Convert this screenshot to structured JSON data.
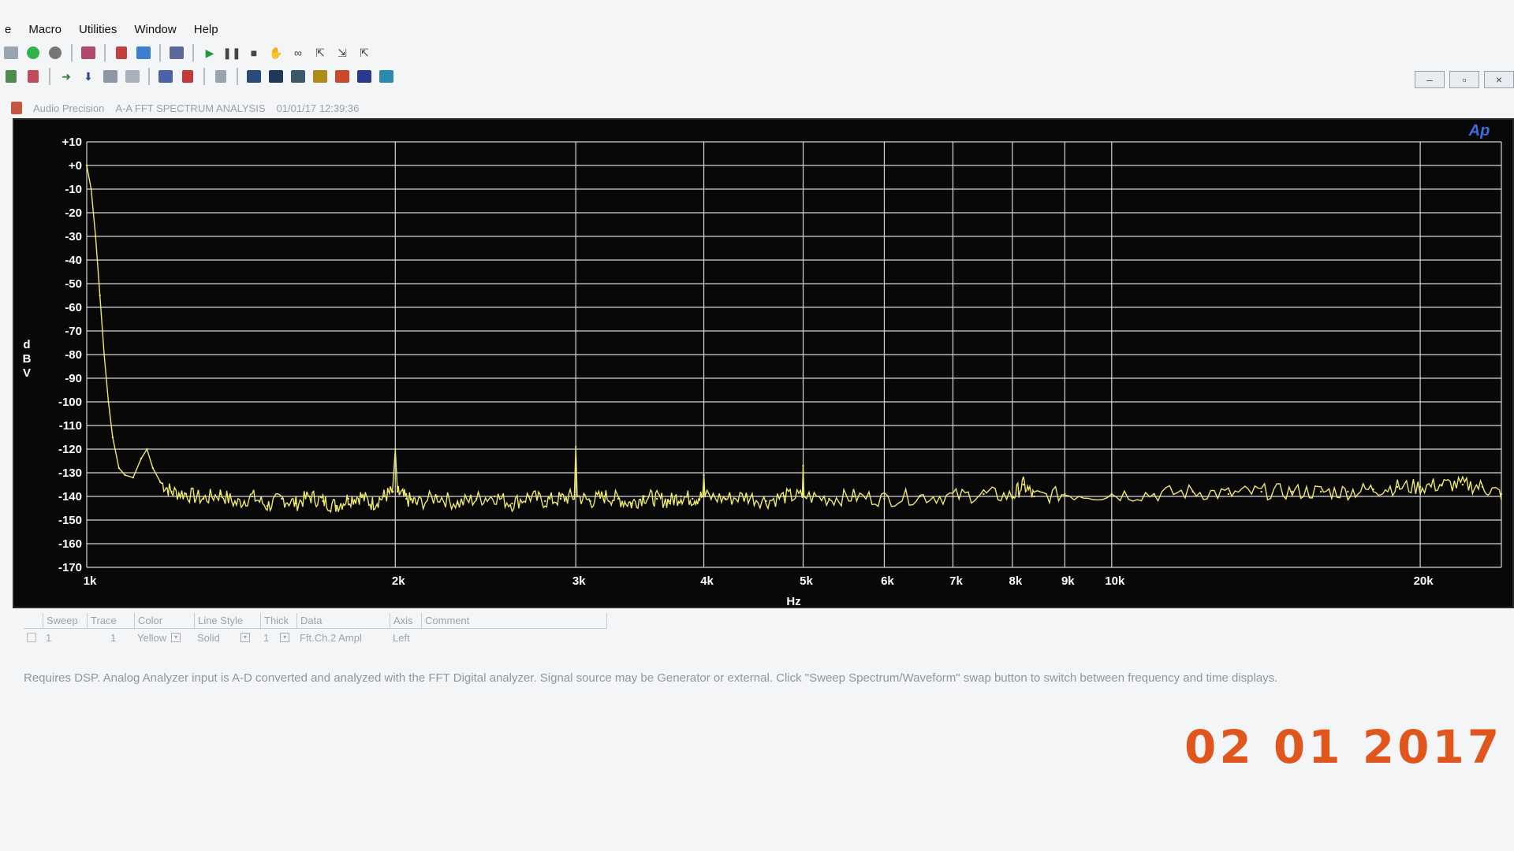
{
  "menu": [
    "e",
    "Macro",
    "Utilities",
    "Window",
    "Help"
  ],
  "toolbar_icons": {
    "row1": [
      "open-icon",
      "run-green-icon",
      "stop-circle-icon",
      "sweep-icon",
      "copy-icon",
      "paste-icon",
      "panel-icon",
      "play-icon",
      "pause-icon",
      "stop-icon",
      "hand-icon",
      "zoom-icon",
      "cursor-icon",
      "graph-in-icon",
      "graph-out-icon"
    ],
    "row2": [
      "tool-a-icon",
      "tool-b-icon",
      "arrow-right-icon",
      "arrow-down-icon",
      "grid-icon",
      "table-icon",
      "meter-icon",
      "filter-icon",
      "page-icon",
      "graph1-icon",
      "graph2-icon",
      "graph3-icon",
      "graph4-icon",
      "graph5-icon",
      "graph6-icon",
      "graph7-icon"
    ]
  },
  "window_controls": [
    "–",
    "▫",
    "×"
  ],
  "graph_window": {
    "app": "Audio Precision",
    "title": "A-A FFT SPECTRUM ANALYSIS",
    "timestamp": "01/01/17 12:39:36",
    "logo": "Ap"
  },
  "colors": {
    "trace": "#ede86a",
    "grid": "#d6d6d6",
    "background": "#080808",
    "date_stamp": "#e0561c"
  },
  "chart_data": {
    "type": "line",
    "xlabel": "Hz",
    "ylabel": "dBV",
    "x_scale": "log",
    "xlim": [
      1000,
      24000
    ],
    "ylim": [
      -170,
      10
    ],
    "grid": true,
    "x_ticks": [
      {
        "v": 1000,
        "label": "1k"
      },
      {
        "v": 2000,
        "label": "2k"
      },
      {
        "v": 3000,
        "label": "3k"
      },
      {
        "v": 4000,
        "label": "4k"
      },
      {
        "v": 5000,
        "label": "5k"
      },
      {
        "v": 6000,
        "label": "6k"
      },
      {
        "v": 7000,
        "label": "7k"
      },
      {
        "v": 8000,
        "label": "8k"
      },
      {
        "v": 9000,
        "label": "9k"
      },
      {
        "v": 10000,
        "label": "10k"
      },
      {
        "v": 20000,
        "label": "20k"
      }
    ],
    "y_ticks": [
      {
        "v": 10,
        "label": "+10"
      },
      {
        "v": 0,
        "label": "+0"
      },
      {
        "v": -10,
        "label": "-10"
      },
      {
        "v": -20,
        "label": "-20"
      },
      {
        "v": -30,
        "label": "-30"
      },
      {
        "v": -40,
        "label": "-40"
      },
      {
        "v": -50,
        "label": "-50"
      },
      {
        "v": -60,
        "label": "-60"
      },
      {
        "v": -70,
        "label": "-70"
      },
      {
        "v": -80,
        "label": "-80"
      },
      {
        "v": -90,
        "label": "-90"
      },
      {
        "v": -100,
        "label": "-100"
      },
      {
        "v": -110,
        "label": "-110"
      },
      {
        "v": -120,
        "label": "-120"
      },
      {
        "v": -130,
        "label": "-130"
      },
      {
        "v": -140,
        "label": "-140"
      },
      {
        "v": -150,
        "label": "-150"
      },
      {
        "v": -160,
        "label": "-160"
      },
      {
        "v": -170,
        "label": "-170"
      }
    ],
    "series": [
      {
        "points": [
          [
            1000,
            0
          ],
          [
            1010,
            -10
          ],
          [
            1020,
            -30
          ],
          [
            1030,
            -55
          ],
          [
            1040,
            -80
          ],
          [
            1050,
            -100
          ],
          [
            1060,
            -115
          ],
          [
            1075,
            -128
          ],
          [
            1090,
            -131
          ],
          [
            1110,
            -132
          ],
          [
            1130,
            -124
          ],
          [
            1145,
            -120
          ],
          [
            1160,
            -128
          ],
          [
            1180,
            -134
          ],
          [
            1210,
            -138
          ],
          [
            1250,
            -139
          ],
          [
            1300,
            -141
          ],
          [
            1350,
            -139
          ],
          [
            1400,
            -143
          ],
          [
            1450,
            -140
          ],
          [
            1500,
            -144
          ],
          [
            1550,
            -141
          ],
          [
            1600,
            -143
          ],
          [
            1650,
            -140
          ],
          [
            1700,
            -142
          ],
          [
            1750,
            -144
          ],
          [
            1800,
            -141
          ],
          [
            1850,
            -140
          ],
          [
            1900,
            -143
          ],
          [
            1950,
            -140
          ],
          [
            1990,
            -138
          ],
          [
            2000,
            -120
          ],
          [
            2010,
            -138
          ],
          [
            2050,
            -141
          ],
          [
            2100,
            -143
          ],
          [
            2200,
            -140
          ],
          [
            2300,
            -143
          ],
          [
            2400,
            -141
          ],
          [
            2500,
            -140
          ],
          [
            2600,
            -143
          ],
          [
            2700,
            -140
          ],
          [
            2800,
            -142
          ],
          [
            2900,
            -141
          ],
          [
            2990,
            -140
          ],
          [
            3000,
            -119
          ],
          [
            3010,
            -140
          ],
          [
            3100,
            -142
          ],
          [
            3200,
            -140
          ],
          [
            3300,
            -141
          ],
          [
            3400,
            -143
          ],
          [
            3500,
            -140
          ],
          [
            3600,
            -141
          ],
          [
            3700,
            -142
          ],
          [
            3800,
            -140
          ],
          [
            3900,
            -141
          ],
          [
            3990,
            -140
          ],
          [
            4000,
            -131
          ],
          [
            4010,
            -140
          ],
          [
            4200,
            -141
          ],
          [
            4400,
            -140
          ],
          [
            4600,
            -142
          ],
          [
            4800,
            -140
          ],
          [
            4990,
            -140
          ],
          [
            5000,
            -127
          ],
          [
            5010,
            -140
          ],
          [
            5300,
            -141
          ],
          [
            5600,
            -140
          ],
          [
            6000,
            -141
          ],
          [
            6500,
            -140
          ],
          [
            7000,
            -140
          ],
          [
            7500,
            -139
          ],
          [
            8000,
            -140
          ],
          [
            8200,
            -135
          ],
          [
            8400,
            -140
          ],
          [
            9000,
            -139
          ],
          [
            10000,
            -139
          ],
          [
            11000,
            -139
          ],
          [
            12000,
            -138
          ],
          [
            13000,
            -139
          ],
          [
            14000,
            -138
          ],
          [
            15000,
            -138
          ],
          [
            16000,
            -138
          ],
          [
            17000,
            -138
          ],
          [
            18000,
            -137
          ],
          [
            19000,
            -136
          ],
          [
            20000,
            -136
          ],
          [
            21000,
            -135
          ],
          [
            22000,
            -135
          ],
          [
            23000,
            -136
          ],
          [
            24000,
            -139
          ]
        ]
      }
    ]
  },
  "legend": {
    "headers": [
      "Sweep",
      "Trace",
      "Color",
      "Line Style",
      "Thick",
      "Data",
      "Axis",
      "Comment"
    ],
    "row": [
      "1",
      "1",
      "Yellow",
      "Solid",
      "1",
      "Fft.Ch.2 Ampl",
      "Left",
      ""
    ]
  },
  "description": "Requires DSP.  Analog Analyzer input is A-D converted and analyzed with the FFT Digital analyzer.  Signal source may be Generator or external.  Click \"Sweep Spectrum/Waveform\" swap button to switch between frequency and time displays.",
  "date_stamp": "02 01 2017"
}
